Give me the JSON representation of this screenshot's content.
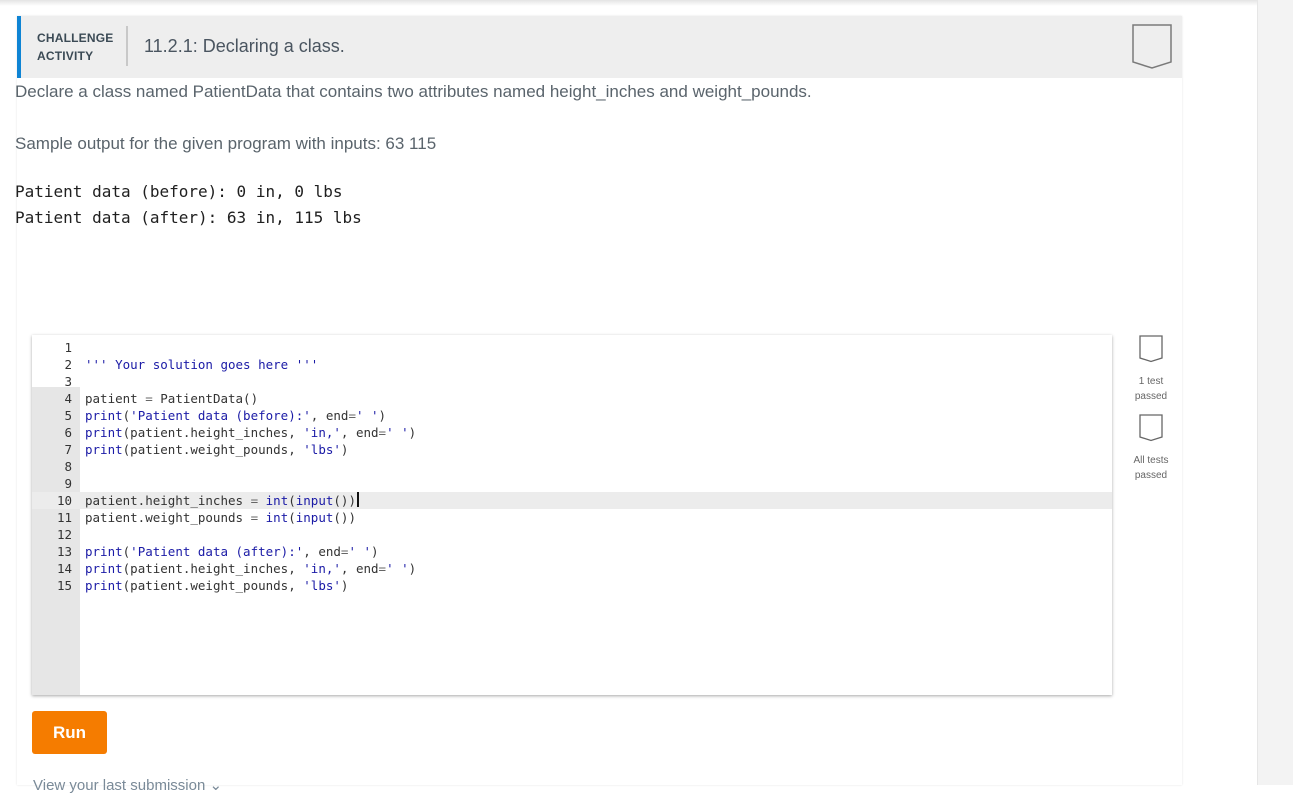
{
  "header": {
    "activity_type_line1": "CHALLENGE",
    "activity_type_line2": "ACTIVITY",
    "title": "11.2.1: Declaring a class.",
    "completion_badge_icon": "bookmark-badge-icon"
  },
  "prompt": {
    "instructions": "Declare a class named PatientData that contains two attributes named height_inches and weight_pounds.",
    "sample_label": "Sample output for the given program with inputs: 63 115",
    "sample_output": [
      "Patient data (before): 0 in, 0 lbs",
      "Patient data (after): 63 in, 115 lbs"
    ]
  },
  "editor": {
    "active_line": 10,
    "lines": [
      {
        "n": "1",
        "code": ""
      },
      {
        "n": "2",
        "code": "''' Your solution goes here '''"
      },
      {
        "n": "3",
        "code": ""
      },
      {
        "n": "4",
        "code": "patient = PatientData()"
      },
      {
        "n": "5",
        "code": "print('Patient data (before):', end=' ')"
      },
      {
        "n": "6",
        "code": "print(patient.height_inches, 'in,', end=' ')"
      },
      {
        "n": "7",
        "code": "print(patient.weight_pounds, 'lbs')"
      },
      {
        "n": "8",
        "code": ""
      },
      {
        "n": "9",
        "code": ""
      },
      {
        "n": "10",
        "code": "patient.height_inches = int(input())"
      },
      {
        "n": "11",
        "code": "patient.weight_pounds = int(input())"
      },
      {
        "n": "12",
        "code": ""
      },
      {
        "n": "13",
        "code": "print('Patient data (after):', end=' ')"
      },
      {
        "n": "14",
        "code": "print(patient.height_inches, 'in,', end=' ')"
      },
      {
        "n": "15",
        "code": "print(patient.weight_pounds, 'lbs')"
      }
    ]
  },
  "tests": [
    {
      "label_line1": "1 test",
      "label_line2": "passed",
      "icon": "test-badge-icon"
    },
    {
      "label_line1": "All tests",
      "label_line2": "passed",
      "icon": "test-badge-icon"
    }
  ],
  "actions": {
    "run_label": "Run",
    "last_submission_label": "View your last submission ⌄"
  },
  "colors": {
    "accent": "#0e84d4",
    "run_button": "#f57c00",
    "header_bg": "#eeeeee",
    "code_keyword": "#1a1aa6"
  }
}
